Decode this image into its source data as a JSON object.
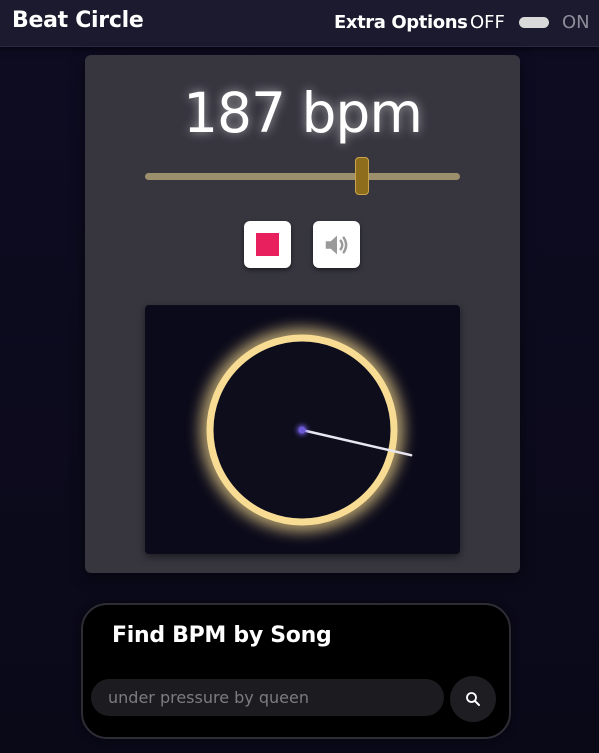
{
  "app": {
    "title": "Beat Circle"
  },
  "header": {
    "extra_options_label": "Extra Options",
    "toggle_off_label": "OFF",
    "toggle_on_label": "ON",
    "toggle_state": "off"
  },
  "tempo": {
    "bpm_display": "187 bpm",
    "bpm_value": 187,
    "slider_fraction": 0.69
  },
  "controls": {
    "stop_icon": "stop-icon",
    "stop_color": "#e8205e",
    "sound_icon": "speaker-icon"
  },
  "visualizer": {
    "ring_color": "#f8dc94",
    "hand_angle_deg": 13,
    "center_dot_color": "#6a5ad8"
  },
  "song_search": {
    "title": "Find BPM by Song",
    "input_value": "",
    "placeholder": "under pressure by queen",
    "search_icon": "search-icon"
  }
}
